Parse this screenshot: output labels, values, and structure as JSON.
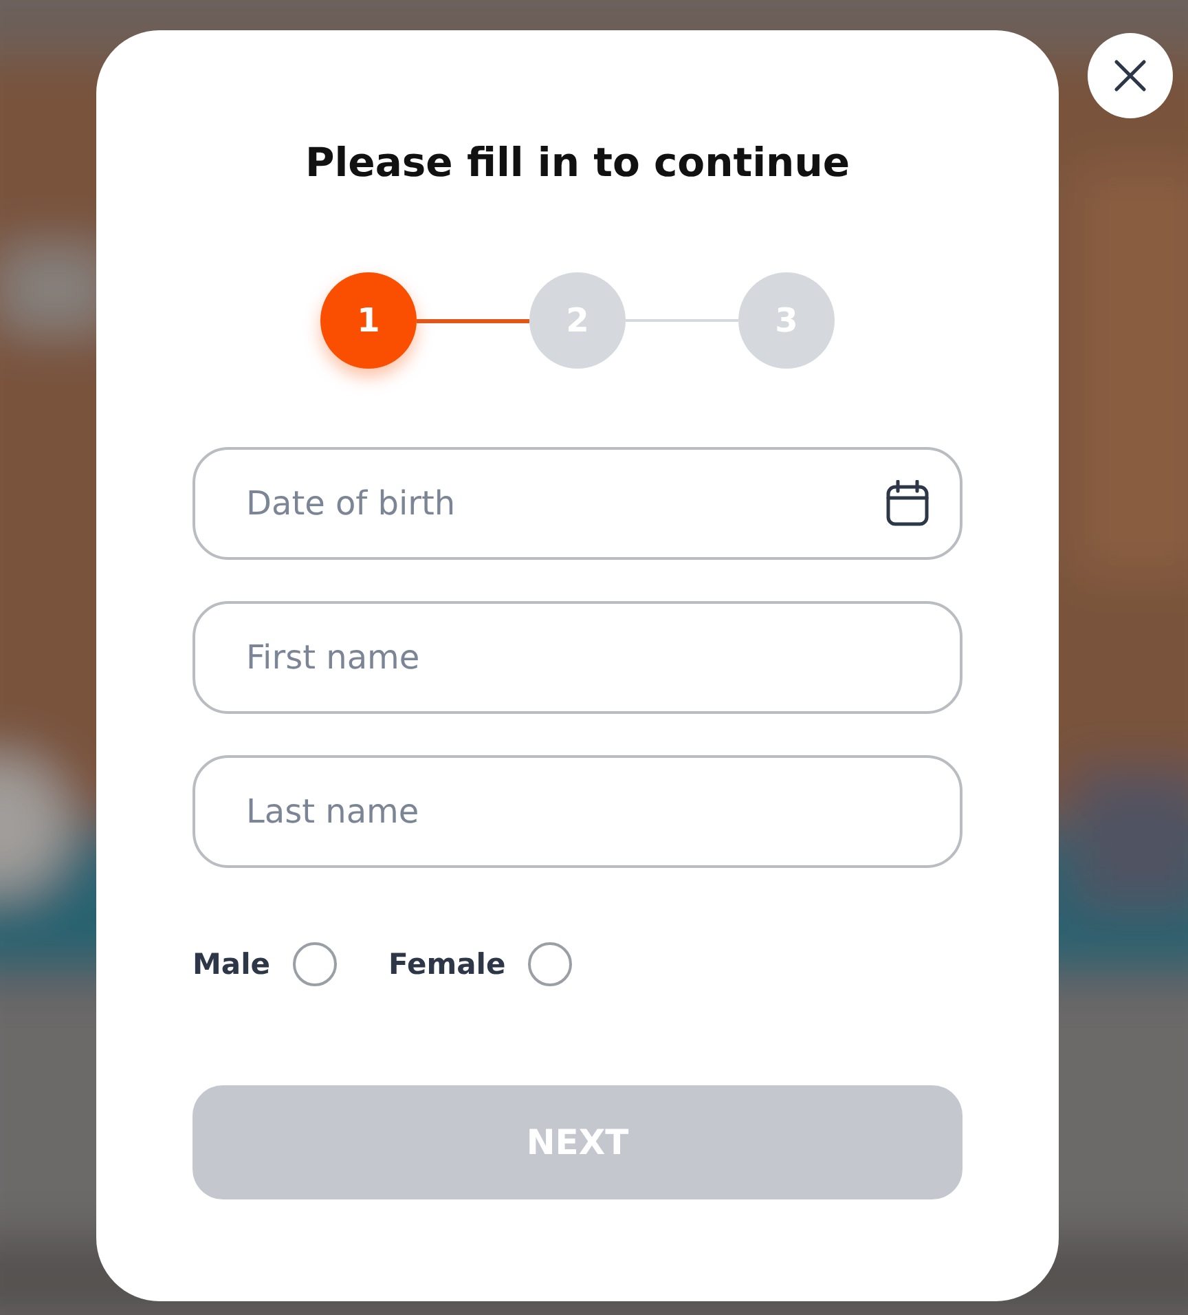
{
  "title": "Please fill in to continue",
  "steps": [
    {
      "label": "1",
      "selected": true
    },
    {
      "label": "2",
      "selected": false
    },
    {
      "label": "3",
      "selected": false
    }
  ],
  "fields": [
    {
      "kind": "date",
      "placeholder": "Date of birth"
    },
    {
      "kind": "text",
      "placeholder": "First name"
    },
    {
      "kind": "text",
      "placeholder": "Last name"
    }
  ],
  "gender_options": [
    {
      "label": "Male",
      "selected": false
    },
    {
      "label": "Female",
      "selected": false
    }
  ],
  "next_button": {
    "label": "NEXT",
    "disabled": true
  }
}
